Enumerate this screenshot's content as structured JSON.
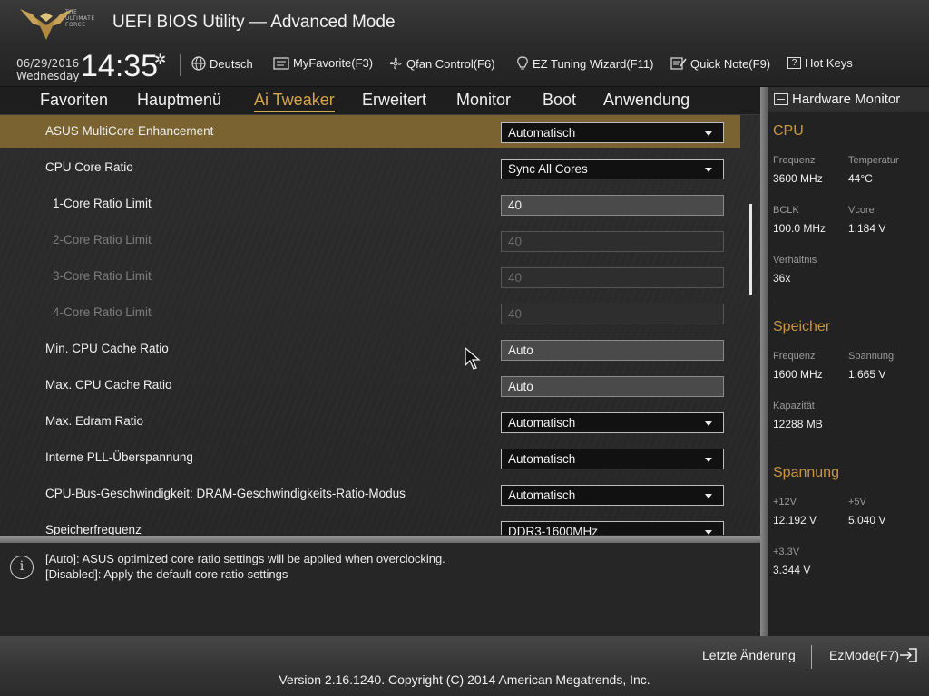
{
  "header": {
    "logo_text": [
      "THE",
      "ULTIMATE",
      "FORCE"
    ],
    "title": "UEFI BIOS Utility — Advanced Mode",
    "date": "06/29/2016",
    "weekday": "Wednesday",
    "time": "14:35",
    "items": {
      "language": "Deutsch",
      "myfavorite": "MyFavorite(F3)",
      "qfan": "Qfan Control(F6)",
      "ez_tuning": "EZ Tuning Wizard(F11)",
      "quick_note": "Quick Note(F9)",
      "hot_keys": "Hot Keys",
      "hot_keys_glyph": "?"
    }
  },
  "tabs": [
    "Favoriten",
    "Hauptmenü",
    "Ai Tweaker",
    "Erweitert",
    "Monitor",
    "Boot",
    "Anwendung"
  ],
  "settings": {
    "multicore": {
      "label": "ASUS MultiCore Enhancement",
      "value": "Automatisch"
    },
    "cpu_core_ratio": {
      "label": "CPU Core Ratio",
      "value": "Sync All Cores"
    },
    "core1": {
      "label": "1-Core Ratio Limit",
      "value": "40"
    },
    "core2": {
      "label": "2-Core Ratio Limit",
      "value": "40"
    },
    "core3": {
      "label": "3-Core Ratio Limit",
      "value": "40"
    },
    "core4": {
      "label": "4-Core Ratio Limit",
      "value": "40"
    },
    "min_cache": {
      "label": "Min. CPU Cache Ratio",
      "value": "Auto"
    },
    "max_cache": {
      "label": "Max. CPU Cache Ratio",
      "value": "Auto"
    },
    "max_edram": {
      "label": "Max. Edram Ratio",
      "value": "Automatisch"
    },
    "pll": {
      "label": "Interne PLL-Überspannung",
      "value": "Automatisch"
    },
    "bus_speed": {
      "label": "CPU-Bus-Geschwindigkeit: DRAM-Geschwindigkeits-Ratio-Modus",
      "value": "Automatisch"
    },
    "mem_freq": {
      "label": "Speicherfrequenz",
      "value": "DDR3-1600MHz"
    }
  },
  "help": {
    "icon_glyph": "i",
    "line1": "[Auto]: ASUS optimized core ratio settings will be applied when overclocking.",
    "line2": "[Disabled]: Apply the default core ratio settings"
  },
  "hardware_monitor": {
    "title": "Hardware Monitor",
    "cpu": {
      "heading": "CPU",
      "freq_label": "Frequenz",
      "freq_value": "3600 MHz",
      "temp_label": "Temperatur",
      "temp_value": "44°C",
      "bclk_label": "BCLK",
      "bclk_value": "100.0 MHz",
      "vcore_label": "Vcore",
      "vcore_value": "1.184 V",
      "ratio_label": "Verhältnis",
      "ratio_value": "36x"
    },
    "memory": {
      "heading": "Speicher",
      "freq_label": "Frequenz",
      "freq_value": "1600 MHz",
      "volt_label": "Spannung",
      "volt_value": "1.665 V",
      "cap_label": "Kapazität",
      "cap_value": "12288 MB"
    },
    "voltage": {
      "heading": "Spannung",
      "v12_label": "+12V",
      "v12_value": "12.192 V",
      "v5_label": "+5V",
      "v5_value": "5.040 V",
      "v33_label": "+3.3V",
      "v33_value": "3.344 V"
    }
  },
  "footer": {
    "last_change": "Letzte Änderung",
    "ezmode": "EzMode(F7)",
    "copyright": "Version 2.16.1240. Copyright (C) 2014 American Megatrends, Inc."
  },
  "colors": {
    "accent": "#d6a44a",
    "highlight_row": "#7a6330",
    "section_heading": "#c8963f"
  }
}
